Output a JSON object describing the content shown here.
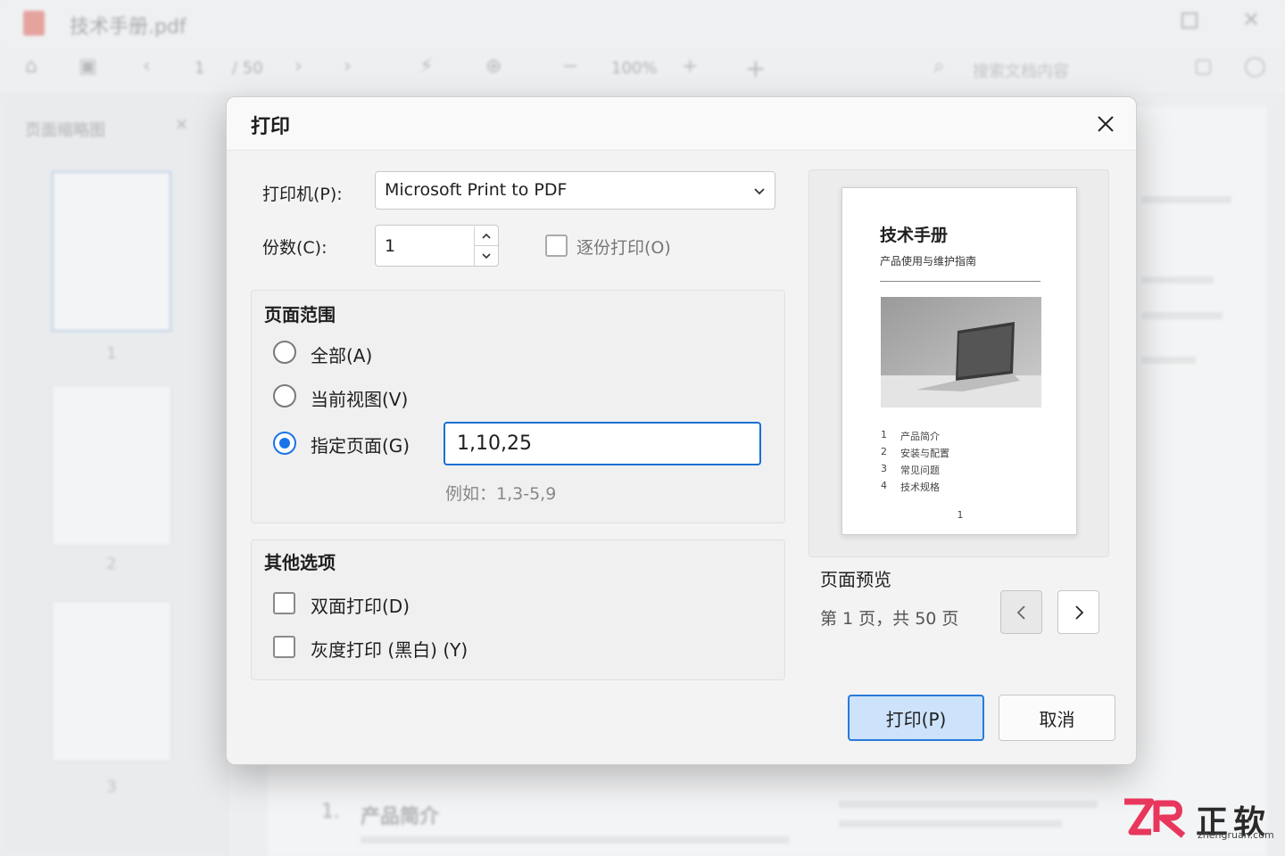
{
  "app": {
    "window_title": "技术手册.pdf",
    "toolbar": {
      "page_current": "1",
      "page_total": "/ 50",
      "zoom": "100%",
      "search_placeholder": "搜索文档内容"
    },
    "sidebar": {
      "title": "页面缩略图",
      "thumbnails": [
        {
          "label": "1"
        },
        {
          "label": "2"
        },
        {
          "label": "3"
        }
      ]
    },
    "doc_body": {
      "section_number": "1.",
      "section_title": "产品简介"
    }
  },
  "dialog": {
    "title": "打印",
    "printer_label": "打印机(P):",
    "printer_value": "Microsoft Print to PDF",
    "copies_label": "份数(C):",
    "copies_value": "1",
    "collate_label": "逐份打印(O)",
    "collate_checked": false,
    "page_range": {
      "title": "页面范围",
      "options": [
        {
          "label": "全部(A)",
          "selected": false
        },
        {
          "label": "当前视图(V)",
          "selected": false
        },
        {
          "label": "指定页面(G)",
          "selected": true
        }
      ],
      "pages_value": "1,10,25",
      "hint": "例如：1,3-5,9"
    },
    "other_options": {
      "title": "其他选项",
      "duplex_label": "双面打印(D)",
      "duplex_checked": false,
      "grayscale_label": "灰度打印 (黑白) (Y)",
      "grayscale_checked": false
    },
    "preview": {
      "page_title": "技术手册",
      "page_subtitle": "产品使用与维护指南",
      "toc": [
        {
          "num": "1",
          "text": "产品简介"
        },
        {
          "num": "2",
          "text": "安装与配置"
        },
        {
          "num": "3",
          "text": "常见问题"
        },
        {
          "num": "4",
          "text": "技术规格"
        }
      ],
      "page_number": "1",
      "label": "页面预览",
      "page_info": "第 1 页，共 50 页"
    },
    "print_button": "打印(P)",
    "cancel_button": "取消"
  },
  "watermark": {
    "brand": "正软",
    "url": "zhengruan.com",
    "accent_color": "#e8365d"
  }
}
